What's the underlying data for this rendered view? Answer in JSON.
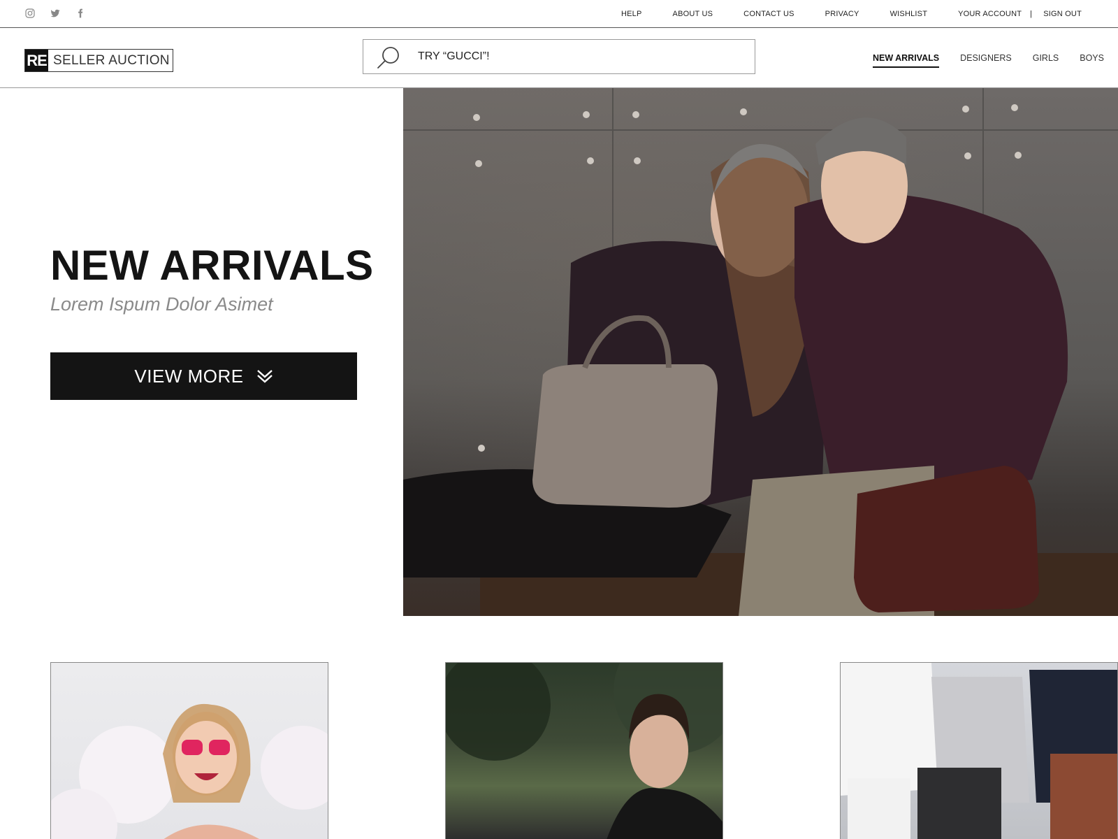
{
  "topbar": {
    "social_icons": [
      "instagram-icon",
      "twitter-icon",
      "facebook-icon"
    ],
    "links": [
      "HELP",
      "ABOUT US",
      "CONTACT US",
      "PRIVACY",
      "WISHLIST",
      "YOUR ACCOUNT"
    ],
    "separator": "|",
    "sign_out": "SIGN OUT"
  },
  "header": {
    "logo_mark": "RE",
    "logo_text": "SELLER AUCTION",
    "search_placeholder": "TRY “GUCCI”!",
    "nav": [
      {
        "label": "NEW ARRIVALS",
        "active": true
      },
      {
        "label": "DESIGNERS",
        "active": false
      },
      {
        "label": "GIRLS",
        "active": false
      },
      {
        "label": "BOYS",
        "active": false
      }
    ]
  },
  "hero": {
    "title": "NEW ARRIVALS",
    "subtitle": "Lorem Ispum Dolor Asimet",
    "button_label": "VIEW MORE"
  },
  "colors": {
    "primary_dark": "#141414",
    "subtitle_gray": "#8a8a8a",
    "border": "#999999"
  }
}
